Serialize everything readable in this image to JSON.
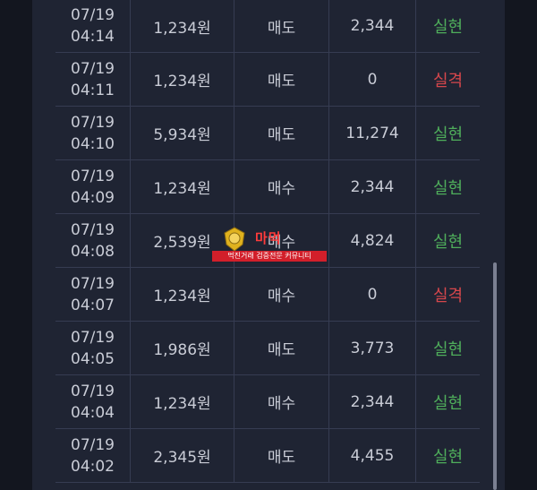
{
  "rows": [
    {
      "date": "07/19",
      "time": "04:14",
      "price": "1,234원",
      "type": "매도",
      "profit": "2,344",
      "result": "실현",
      "result_kind": "win"
    },
    {
      "date": "07/19",
      "time": "04:11",
      "price": "1,234원",
      "type": "매도",
      "profit": "0",
      "result": "실격",
      "result_kind": "loss"
    },
    {
      "date": "07/19",
      "time": "04:10",
      "price": "5,934원",
      "type": "매도",
      "profit": "11,274",
      "result": "실현",
      "result_kind": "win"
    },
    {
      "date": "07/19",
      "time": "04:09",
      "price": "1,234원",
      "type": "매수",
      "profit": "2,344",
      "result": "실현",
      "result_kind": "win"
    },
    {
      "date": "07/19",
      "time": "04:08",
      "price": "2,539원",
      "type": "매수",
      "profit": "4,824",
      "result": "실현",
      "result_kind": "win"
    },
    {
      "date": "07/19",
      "time": "04:07",
      "price": "1,234원",
      "type": "매수",
      "profit": "0",
      "result": "실격",
      "result_kind": "loss"
    },
    {
      "date": "07/19",
      "time": "04:05",
      "price": "1,986원",
      "type": "매도",
      "profit": "3,773",
      "result": "실현",
      "result_kind": "win"
    },
    {
      "date": "07/19",
      "time": "04:04",
      "price": "1,234원",
      "type": "매수",
      "profit": "2,344",
      "result": "실현",
      "result_kind": "win"
    },
    {
      "date": "07/19",
      "time": "04:02",
      "price": "2,345원",
      "type": "매도",
      "profit": "4,455",
      "result": "실현",
      "result_kind": "win"
    }
  ],
  "watermark": {
    "brand": "마먹",
    "tagline": "먹진거래 검증전문 커뮤니티"
  },
  "colors": {
    "win": "#4fae5b",
    "loss": "#d7474c",
    "background": "#1f2433"
  }
}
